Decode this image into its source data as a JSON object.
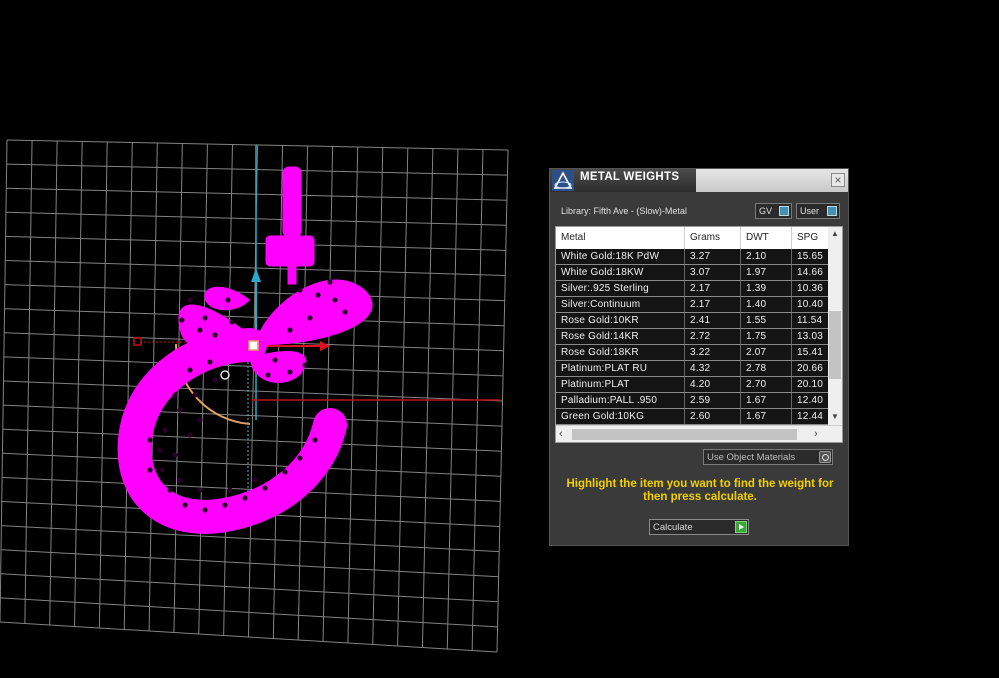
{
  "dialog": {
    "title": "METAL WEIGHTS",
    "close_label": "×",
    "library_label": "Library: Fifth Ave - (Slow)-Metal",
    "gv_label": "GV",
    "user_label": "User",
    "columns": [
      "Metal",
      "Grams",
      "DWT",
      "SPG"
    ],
    "rows": [
      {
        "metal": "White Gold:18K PdW",
        "grams": "3.27",
        "dwt": "2.10",
        "spg": "15.65"
      },
      {
        "metal": "White Gold:18KW",
        "grams": "3.07",
        "dwt": "1.97",
        "spg": "14.66"
      },
      {
        "metal": "Silver:.925 Sterling",
        "grams": "2.17",
        "dwt": "1.39",
        "spg": "10.36"
      },
      {
        "metal": "Silver:Continuum",
        "grams": "2.17",
        "dwt": "1.40",
        "spg": "10.40"
      },
      {
        "metal": "Rose Gold:10KR",
        "grams": "2.41",
        "dwt": "1.55",
        "spg": "11.54"
      },
      {
        "metal": "Rose Gold:14KR",
        "grams": "2.72",
        "dwt": "1.75",
        "spg": "13.03"
      },
      {
        "metal": "Rose Gold:18KR",
        "grams": "3.22",
        "dwt": "2.07",
        "spg": "15.41"
      },
      {
        "metal": "Platinum:PLAT RU",
        "grams": "4.32",
        "dwt": "2.78",
        "spg": "20.66"
      },
      {
        "metal": "Platinum:PLAT",
        "grams": "4.20",
        "dwt": "2.70",
        "spg": "20.10"
      },
      {
        "metal": "Palladium:PALL .950",
        "grams": "2.59",
        "dwt": "1.67",
        "spg": "12.40"
      },
      {
        "metal": "Green Gold:10KG",
        "grams": "2.60",
        "dwt": "1.67",
        "spg": "12.44"
      }
    ],
    "use_object_materials_label": "Use Object Materials",
    "instructions": "Highlight the item you want to find the weight for then press calculate.",
    "calculate_label": "Calculate",
    "instructions_color": "#f0d000"
  },
  "viewport": {
    "shape_color": "#ff00ff",
    "grid_color": "#9a9a9a"
  }
}
